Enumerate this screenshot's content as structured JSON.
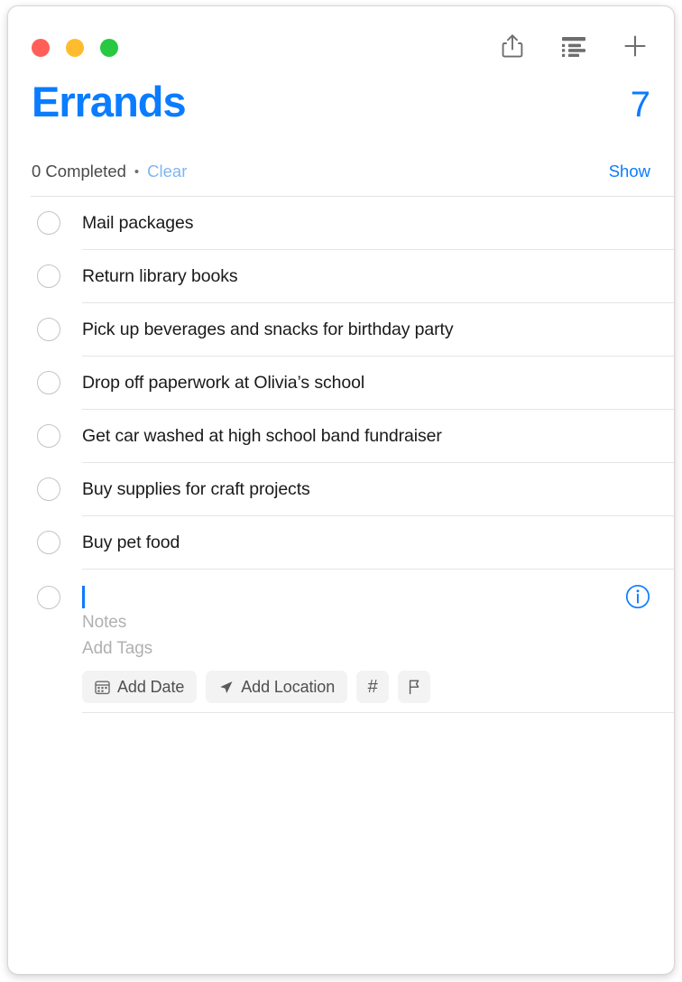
{
  "window": {
    "traffic_lights": [
      {
        "name": "close",
        "color": "#ff5f57"
      },
      {
        "name": "minimize",
        "color": "#febc2e"
      },
      {
        "name": "zoom",
        "color": "#28c840"
      }
    ]
  },
  "toolbar": {
    "share_icon": "share-icon",
    "list_view_icon": "list-view-icon",
    "add_icon": "plus-icon"
  },
  "header": {
    "title": "Errands",
    "title_color": "#0a7cff",
    "count": "7",
    "count_color": "#0a7cff",
    "completed_text": "0 Completed",
    "separator_dot": "•",
    "clear_label": "Clear",
    "clear_color": "#7fb6f2",
    "show_label": "Show",
    "show_color": "#0a7cff"
  },
  "reminders": [
    {
      "title": "Mail packages",
      "completed": false
    },
    {
      "title": "Return library books",
      "completed": false
    },
    {
      "title": "Pick up beverages and snacks for birthday party",
      "completed": false
    },
    {
      "title": "Drop off paperwork at Olivia’s school",
      "completed": false
    },
    {
      "title": "Get car washed at high school band fundraiser",
      "completed": false
    },
    {
      "title": "Buy supplies for craft projects",
      "completed": false
    },
    {
      "title": "Buy pet food",
      "completed": false
    }
  ],
  "new_reminder": {
    "title_value": "",
    "notes_placeholder": "Notes",
    "tags_placeholder": "Add Tags",
    "chips": [
      {
        "label": "Add Date",
        "icon": "calendar-icon"
      },
      {
        "label": "Add Location",
        "icon": "location-arrow-icon"
      },
      {
        "label": "#",
        "icon": "hash-icon"
      },
      {
        "label": "",
        "icon": "flag-icon"
      }
    ],
    "info_icon": "info-circle-icon",
    "info_color": "#0a7cff"
  }
}
